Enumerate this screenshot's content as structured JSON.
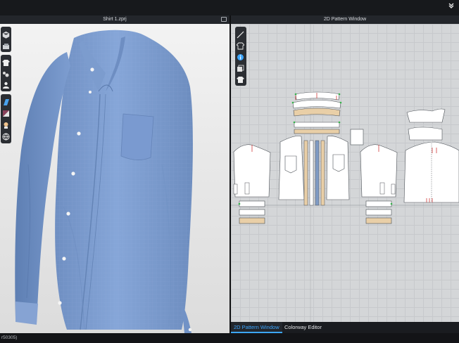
{
  "top_bar": {
    "collapse_icon": "double-chevron-down-icon"
  },
  "view3d": {
    "title": "Shirt 1.zprj"
  },
  "view2d": {
    "title": "2D Pattern Window"
  },
  "tabs": [
    {
      "label": "2D Pattern Window",
      "active": true
    },
    {
      "label": "Colorway Editor",
      "active": false
    }
  ],
  "status": {
    "text": "r50305)"
  },
  "toolbar3d": {
    "group1": [
      "avatar-display-icon",
      "fabric-display-icon"
    ],
    "group2": [
      "shirt-icon",
      "arrangement-icon",
      "avatar-icon"
    ],
    "group3": [
      "texture-icon",
      "lighting-icon",
      "skin-icon",
      "globe-icon"
    ]
  },
  "toolbar2d": [
    "pen-icon",
    "shirt-outline-icon",
    "info-icon",
    "layers-icon",
    "shirt-fill-icon"
  ],
  "colors": {
    "accent": "#3ca6ff",
    "shirt": "#7f9fcf",
    "pattern_piece": "#ffffff",
    "canvas": "#d4d6d8",
    "trim_tan": "#e9cfa7"
  }
}
